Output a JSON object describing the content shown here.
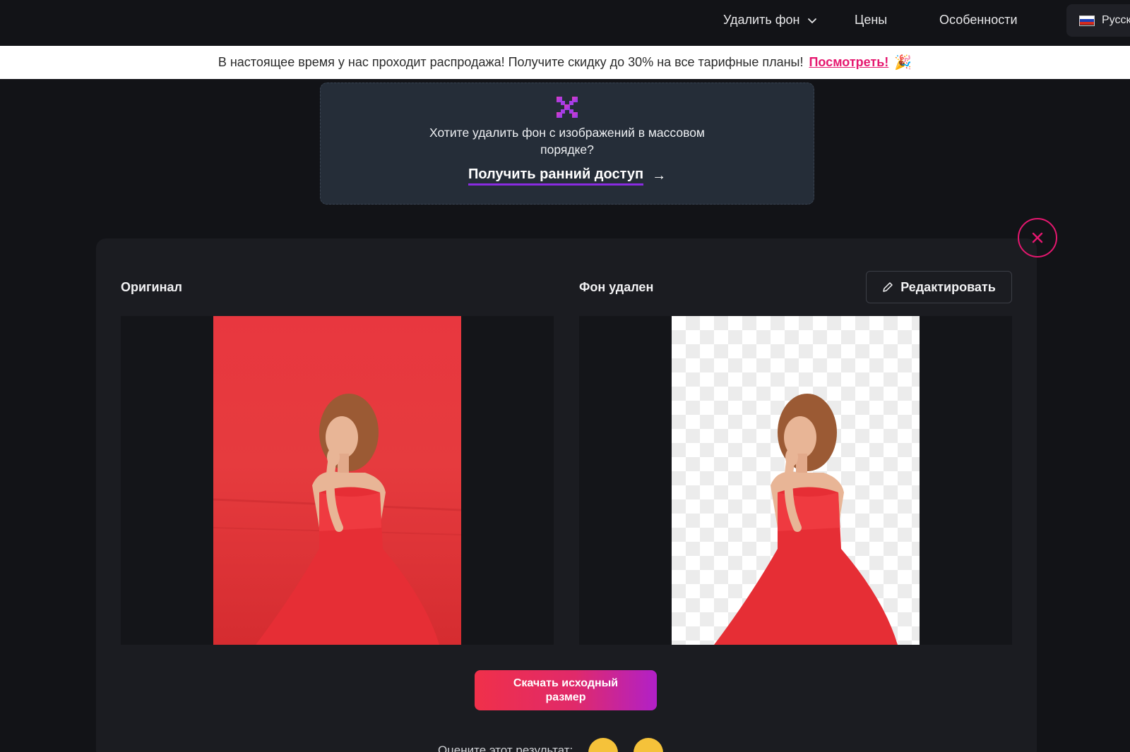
{
  "nav": {
    "remove_bg": "Удалить фон",
    "prices": "Цены",
    "features": "Особенности",
    "language": "Русск"
  },
  "promo": {
    "text": "В настоящее время у нас проходит распродажа! Получите скидку до 30% на все тарифные планы!",
    "link": "Посмотреть!",
    "emoji": "🎉"
  },
  "bulk": {
    "text": "Хотите удалить фон с изображений в массовом порядке?",
    "cta": "Получить ранний доступ",
    "cta_arrow": "→"
  },
  "results": {
    "original_label": "Оригинал",
    "removed_label": "Фон удален",
    "edit_label": "Редактировать",
    "download_label": "Скачать исходный размер",
    "rate_label": "Оцените этот результат:"
  },
  "colors": {
    "accent": "#e5176f",
    "background": "#121317",
    "panel": "#1b1c21",
    "bulk_card": "#252d38"
  },
  "icons": {
    "chevron": "chevron-down-icon",
    "close": "close-icon",
    "edit": "pencil-icon",
    "bulk": "grid-x-icon"
  }
}
